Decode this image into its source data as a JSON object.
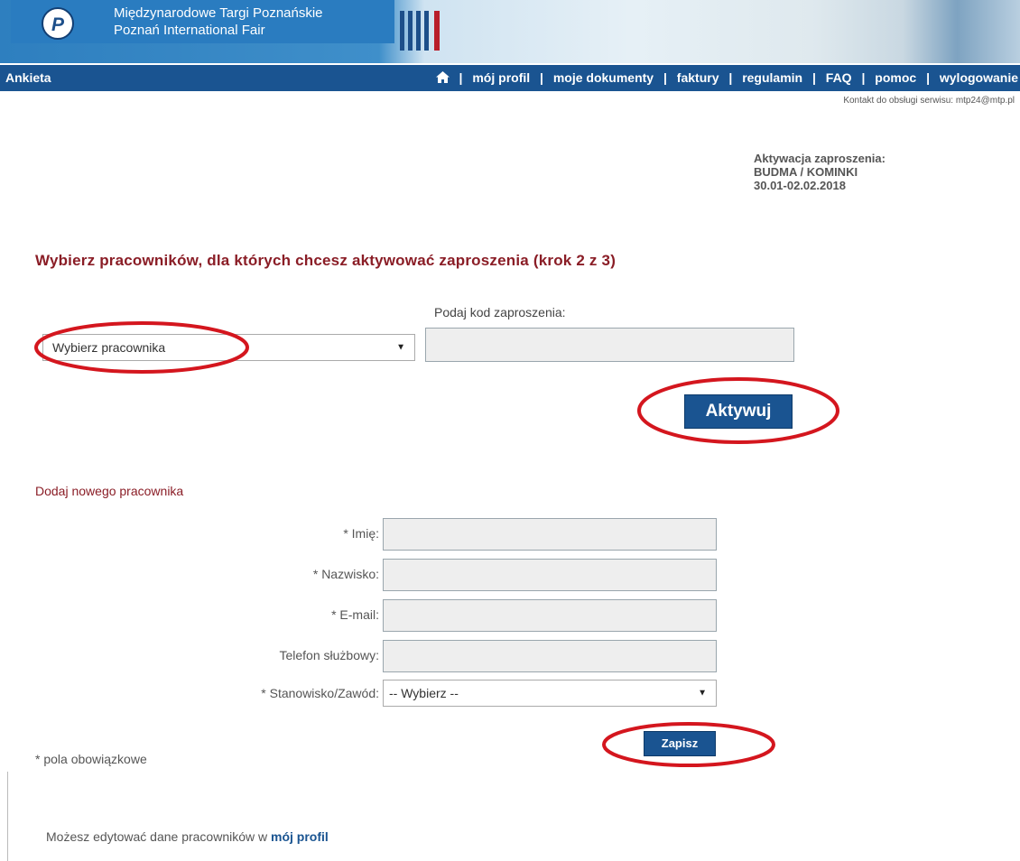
{
  "header": {
    "logo_text": "P",
    "org_name_pl": "Międzynarodowe Targi Poznańskie",
    "org_name_en": "Poznań International Fair"
  },
  "navbar": {
    "section": "Ankieta",
    "home_icon": "home-icon",
    "links": [
      "mój profil",
      "moje dokumenty",
      "faktury",
      "regulamin",
      "FAQ",
      "pomoc",
      "wylogowanie"
    ],
    "separator": "|"
  },
  "contact": "Kontakt do obsługi serwisu: mtp24@mtp.pl",
  "activation": {
    "label": "Aktywacja zaproszenia:",
    "event": "BUDMA / KOMINKI",
    "dates": "30.01-02.02.2018"
  },
  "step_title": "Wybierz pracowników, dla których chcesz aktywować zaproszenia (krok 2 z 3)",
  "invite": {
    "employee_select": "Wybierz pracownika",
    "code_label": "Podaj kod zaproszenia:",
    "code_value": "",
    "activate_button": "Aktywuj"
  },
  "add_employee": {
    "title": "Dodaj nowego pracownika",
    "fields": {
      "first_name": "* Imię:",
      "last_name": "* Nazwisko:",
      "email": "* E-mail:",
      "phone": "Telefon służbowy:",
      "position": "* Stanowisko/Zawód:"
    },
    "position_value": "-- Wybierz --",
    "save_button": "Zapisz"
  },
  "required_note": "* pola obowiązkowe",
  "bottom_note": {
    "text": "Możesz edytować dane pracowników w",
    "link": "mój profil"
  },
  "colors": {
    "nav_blue": "#1a5491",
    "title_red": "#8a1d26",
    "annotation_red": "#d4161e"
  }
}
